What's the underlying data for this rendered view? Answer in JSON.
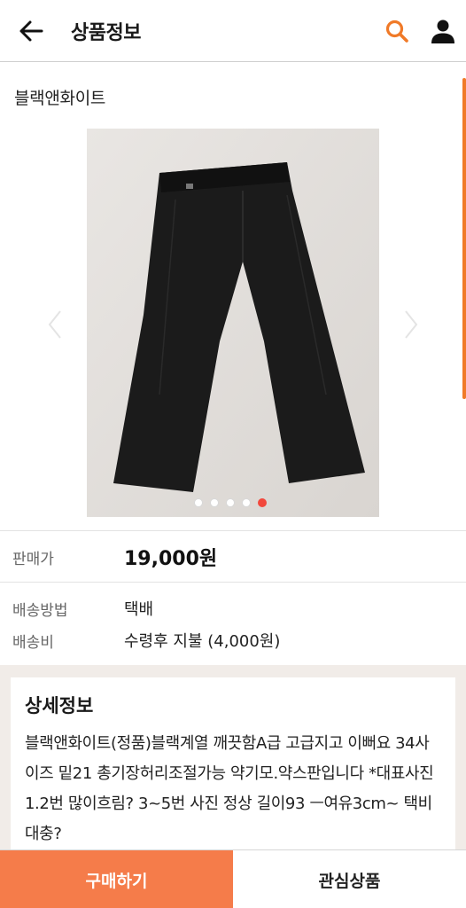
{
  "header": {
    "title": "상품정보",
    "back_icon": "arrow-left-icon",
    "search_icon": "search-icon",
    "user_icon": "user-icon",
    "accent_color": "#f07a28"
  },
  "product": {
    "brand": "블랙앤화이트",
    "image_alt": "black dress trousers photo",
    "image_count": 5,
    "active_image_index": 5
  },
  "price": {
    "label": "판매가",
    "value": "19,000원"
  },
  "shipping": {
    "method_label": "배송방법",
    "method_value": "택배",
    "fee_label": "배송비",
    "fee_value": "수령후 지불 (4,000원)"
  },
  "detail": {
    "title": "상세정보",
    "text": "블랙앤화이트(정품)블랙계열 깨끗함A급 고급지고 이뻐요 34사이즈 밑21 총기장허리조절가능 약기모.약스판입니다 *대표사진1.2번 많이흐림? 3~5번 사진 정상 길이93 ㅡ여유3cm~ 택비대충?"
  },
  "actions": {
    "buy_label": "구매하기",
    "wish_label": "관심상품",
    "buy_color": "#f57c4a"
  }
}
